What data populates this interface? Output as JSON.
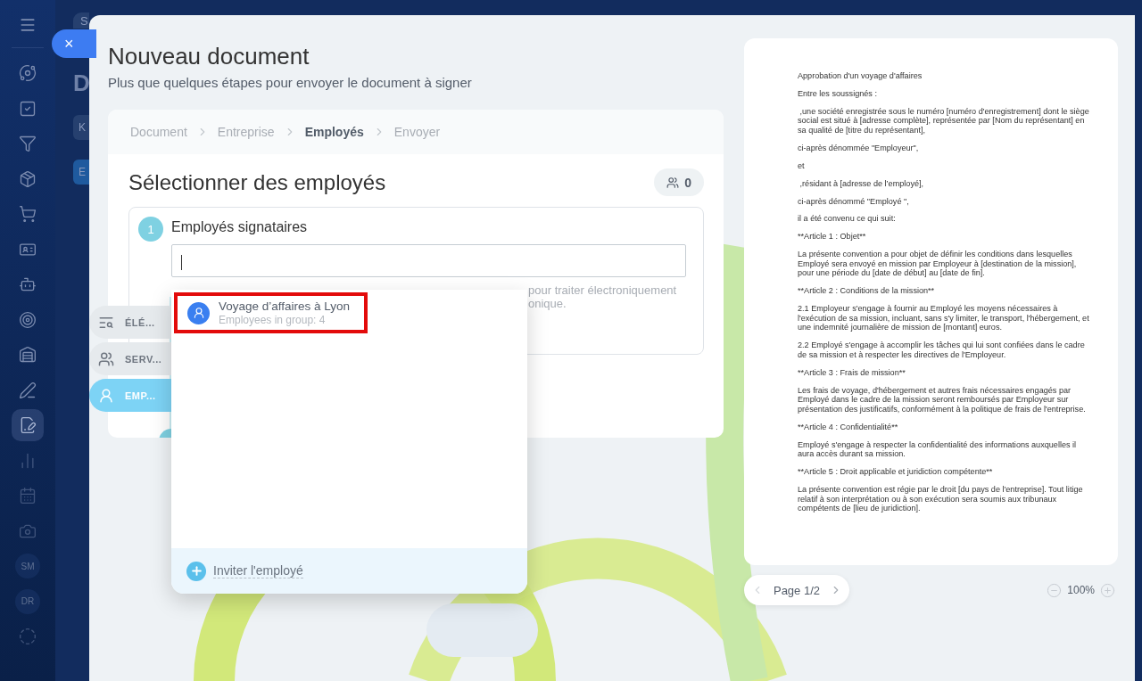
{
  "backdrop": {
    "search_placeholder": "S",
    "title": "D",
    "buttons": [
      "K",
      "E"
    ]
  },
  "close_button": {
    "label": "×"
  },
  "sidebar": {
    "items": [
      {
        "kind": "icon",
        "selected": false
      },
      {
        "kind": "icon",
        "selected": false
      },
      {
        "kind": "icon",
        "selected": false
      },
      {
        "kind": "icon",
        "selected": false
      },
      {
        "kind": "icon",
        "selected": false
      },
      {
        "kind": "icon",
        "selected": false
      },
      {
        "kind": "icon",
        "selected": false
      },
      {
        "kind": "icon",
        "selected": false
      },
      {
        "kind": "icon",
        "selected": false
      },
      {
        "kind": "icon",
        "selected": false
      },
      {
        "kind": "icon",
        "selected": true
      },
      {
        "kind": "icon",
        "selected": false
      },
      {
        "kind": "icon",
        "selected": false
      },
      {
        "kind": "icon",
        "selected": false
      },
      {
        "kind": "initials",
        "label": "SM",
        "selected": false
      },
      {
        "kind": "initials",
        "label": "DR",
        "selected": false
      },
      {
        "kind": "icon",
        "selected": false
      }
    ]
  },
  "header": {
    "title": "Nouveau document",
    "subtitle": "Plus que quelques étapes pour envoyer le document à signer"
  },
  "breadcrumb": [
    {
      "label": "Document",
      "selected": false
    },
    {
      "label": "Entreprise",
      "selected": false
    },
    {
      "label": "Employés",
      "selected": true
    },
    {
      "label": "Envoyer",
      "selected": false
    }
  ],
  "section": {
    "title": "Sélectionner des employés",
    "counter": "0"
  },
  "step": {
    "number": "1",
    "title": "Employés signataires",
    "focused": true,
    "hint_lines": [
      "pour traiter électroniquement",
      "onique."
    ]
  },
  "side_tabs": [
    {
      "label": "ÉLÉ...",
      "selected": false
    },
    {
      "label": "SERV...",
      "selected": false
    },
    {
      "label": "EMP...",
      "selected": true
    }
  ],
  "dropdown": {
    "options": [
      {
        "title": "Voyage d’affaires à Lyon",
        "subtitle": "Employees in group: 4",
        "highlighted": true
      }
    ],
    "footer_action": "Inviter l'employé"
  },
  "preview": {
    "paragraphs": [
      "Approbation d'un voyage d'affaires",
      "Entre les soussignés :",
      " ,une société enregistrée sous le numéro [numéro d'enregistrement] dont le siège social est situé à [adresse complète], représentée par [Nom du représentant] en sa qualité de [titre du représentant],",
      "ci-après dénommée \"Employeur\",",
      "et",
      " ,résidant à [adresse de l’employé],",
      "ci-après dénommé \"Employé \",",
      "il a été convenu ce qui suit:",
      "**Article 1 : Objet**",
      "La présente convention a pour objet de définir les conditions dans lesquelles Employé sera envoyé en mission par Employeur à [destination de la mission], pour une période du [date de début] au [date de fin].",
      "**Article 2 : Conditions de la mission**",
      "2.1 Employeur s'engage à fournir au Employé les moyens nécessaires à l'exécution de sa mission, incluant, sans s'y limiter, le transport, l'hébergement, et une indemnité journalière de mission de [montant] euros.",
      "2.2 Employé s'engage à accomplir les tâches qui lui sont confiées dans le cadre de sa mission et à respecter les directives de l'Employeur.",
      "**Article 3 : Frais de mission**",
      "Les frais de voyage, d'hébergement et autres frais nécessaires engagés par Employé dans le cadre de la mission seront remboursés par Employeur sur présentation des justificatifs, conformément à la politique de frais de l'entreprise.",
      "**Article 4 : Confidentialité**",
      "Employé s'engage à respecter la confidentialité des informations auxquelles il aura accès durant sa mission.",
      "**Article 5 : Droit applicable et juridiction compétente**",
      "La présente convention est régie par le droit [du pays de l'entreprise]. Tout litige relatif à son interprétation ou à son exécution sera soumis aux tribunaux compétents de [lieu de juridiction]."
    ],
    "pager": {
      "label": "Page 1/2",
      "prev_disabled": true,
      "next_disabled": false
    },
    "zoom": "100%"
  }
}
